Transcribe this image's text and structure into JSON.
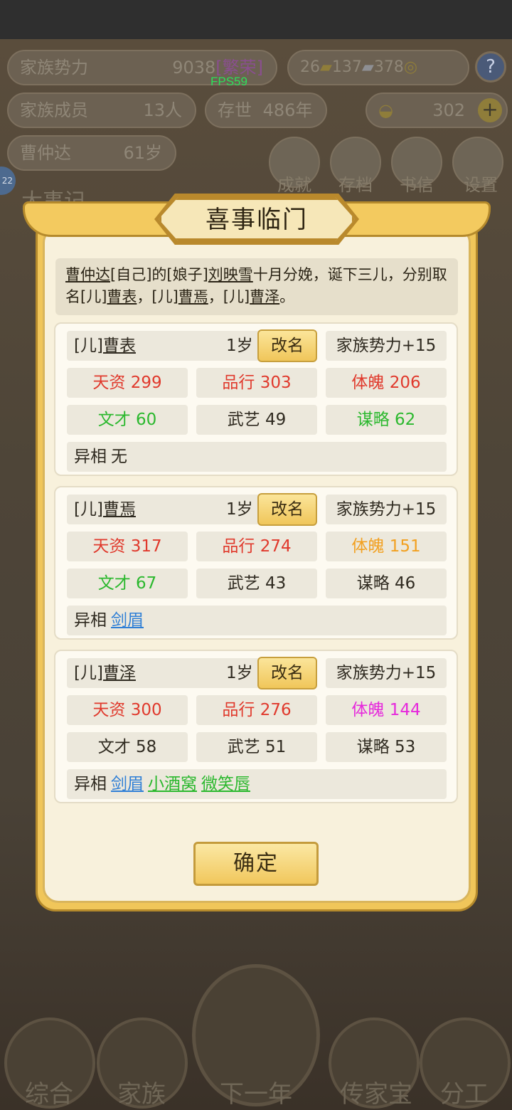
{
  "status": {
    "fps": "FPS59"
  },
  "hud": {
    "family_power_label": "家族势力",
    "family_power_value": "9038",
    "family_power_rank": "[繁荣]",
    "copper": "26",
    "gold_bars": "137",
    "silver_bars": "378",
    "help": "?",
    "members_label": "家族成员",
    "members_value": "13人",
    "existence_label": "存世",
    "existence_value": "486年",
    "ingots": "302",
    "player_name": "曹仲达",
    "player_age": "61岁",
    "menu": [
      "成就",
      "存档",
      "书信",
      "设置"
    ],
    "side_tab": "22",
    "chronicle_title": "大事记",
    "bottom_nav": [
      "综合",
      "家族",
      "下一年",
      "传家宝",
      "分工"
    ]
  },
  "dialog": {
    "title": "喜事临门",
    "announcement": {
      "p1": "曹仲达",
      "p2": "[自己]的[娘子]",
      "p3": "刘映雪",
      "p4": "十月分娩，诞下三儿，分别取名[儿]",
      "p5": "曹表",
      "p6": "，[儿]",
      "p7": "曹焉",
      "p8": "，[儿]",
      "p9": "曹泽",
      "p10": "。"
    },
    "rename_label": "改名",
    "trait_label": "异相",
    "children": [
      {
        "prefix": "[儿]",
        "name": "曹表",
        "age": "1岁",
        "power": "家族势力+15",
        "talent": "天资 299",
        "morality": "品行 303",
        "physique": "体魄 206",
        "literary": "文才 60",
        "martial": "武艺 49",
        "strategy": "谋略 62",
        "traits": [
          "无"
        ]
      },
      {
        "prefix": "[儿]",
        "name": "曹焉",
        "age": "1岁",
        "power": "家族势力+15",
        "talent": "天资 317",
        "morality": "品行 274",
        "physique": "体魄 151",
        "literary": "文才 67",
        "martial": "武艺 43",
        "strategy": "谋略 46",
        "traits": [
          "剑眉"
        ]
      },
      {
        "prefix": "[儿]",
        "name": "曹泽",
        "age": "1岁",
        "power": "家族势力+15",
        "talent": "天资 300",
        "morality": "品行 276",
        "physique": "体魄 144",
        "literary": "文才 58",
        "martial": "武艺 51",
        "strategy": "谋略 53",
        "traits": [
          "剑眉",
          "小酒窝",
          "微笑唇"
        ]
      }
    ],
    "confirm_label": "确定"
  },
  "colors": {
    "red_stat": "#e0392c",
    "green_stat": "#2bb82e",
    "orange_stat": "#f2a020",
    "magenta_stat": "#e628dc",
    "blue_trait": "#2f7fd6",
    "gold_frame": "#f0c65a"
  }
}
